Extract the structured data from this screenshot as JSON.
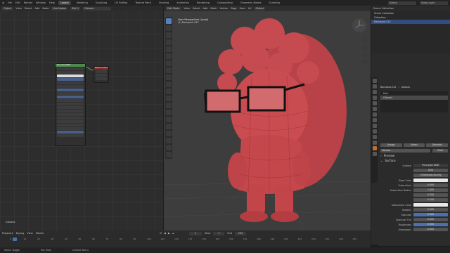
{
  "top_menu": [
    "File",
    "Edit",
    "Render",
    "Window",
    "Help"
  ],
  "workspaces": [
    "Layout",
    "Modeling",
    "Sculpting",
    "UV Editing",
    "Texture Paint",
    "Shading",
    "Animation",
    "Rendering",
    "Compositing",
    "Geometry Nodes",
    "Scripting"
  ],
  "active_workspace": "Layout",
  "scene_field": "Scene",
  "view_layer_field": "View Layer",
  "node_editor": {
    "header": [
      "Object",
      "View",
      "Select",
      "Add",
      "Node",
      "Use Nodes",
      "Slot 1",
      "Glasses"
    ],
    "footer_label": "Glasses",
    "node_main_title": "Principled BSDF",
    "node_output_title": "Material Output"
  },
  "viewport": {
    "mode": "Edit Mode",
    "header": [
      "View",
      "Select",
      "Add",
      "Mesh",
      "Vertex",
      "Edge",
      "Face",
      "UV"
    ],
    "transform": "Global",
    "overlay_title": "User Perspective (Local)",
    "overlay_sub": "(1) Backpack.012"
  },
  "outliner": {
    "header": "Scene Collection",
    "rows": [
      {
        "label": "Scene Collection",
        "selected": false
      },
      {
        "label": "Collection",
        "selected": false
      },
      {
        "label": "Backpack.012",
        "selected": true
      }
    ]
  },
  "properties": {
    "object_name": "Backpack.012",
    "material_name": "Glasses",
    "slots": [
      {
        "label": "Hair",
        "selected": false
      },
      {
        "label": "Glasses",
        "selected": true
      },
      {
        "label": "",
        "selected": false
      },
      {
        "label": "",
        "selected": false
      }
    ],
    "slot_buttons": [
      "Assign",
      "Select",
      "Deselect"
    ],
    "material_field": "Glasses",
    "data_label": "Data",
    "sections": [
      "Preview",
      "Surface"
    ],
    "surface_label": "Surface",
    "surface_value": "Principled BSDF",
    "distribution": "GGX",
    "subsurface_method": "Christensen-Burley",
    "rows": [
      {
        "label": "Base Color",
        "value": "",
        "style": "white"
      },
      {
        "label": "Subsurface",
        "value": "0.000",
        "style": ""
      },
      {
        "label": "Subsurface Radius",
        "value": "1.000",
        "style": ""
      },
      {
        "label": "",
        "value": "0.200",
        "style": ""
      },
      {
        "label": "",
        "value": "0.100",
        "style": ""
      },
      {
        "label": "Subsurface Color",
        "value": "",
        "style": "white"
      },
      {
        "label": "Metallic",
        "value": "0.000",
        "style": ""
      },
      {
        "label": "Specular",
        "value": "0.500",
        "style": "blue"
      },
      {
        "label": "Specular Tint",
        "value": "0.000",
        "style": ""
      },
      {
        "label": "Roughness",
        "value": "0.500",
        "style": "blue"
      },
      {
        "label": "Anisotropic",
        "value": "0.000",
        "style": ""
      }
    ]
  },
  "timeline": {
    "header": [
      "Playback",
      "Keying",
      "View",
      "Marker"
    ],
    "current_frame": "1",
    "start_label": "Start",
    "start": "1",
    "end_label": "End",
    "end": "250",
    "ticks": [
      "0",
      "10",
      "20",
      "30",
      "40",
      "50",
      "60",
      "70",
      "80",
      "90",
      "100",
      "110",
      "120",
      "130",
      "140",
      "150",
      "160",
      "170",
      "180",
      "190",
      "200",
      "210",
      "220",
      "230",
      "240",
      "250"
    ]
  },
  "statusbar": [
    "Select Toggle",
    "Pan View",
    "Context Menu"
  ],
  "colors": {
    "accent": "#5680c2",
    "mesh": "#c2484d",
    "selected_row": "#334d80"
  }
}
